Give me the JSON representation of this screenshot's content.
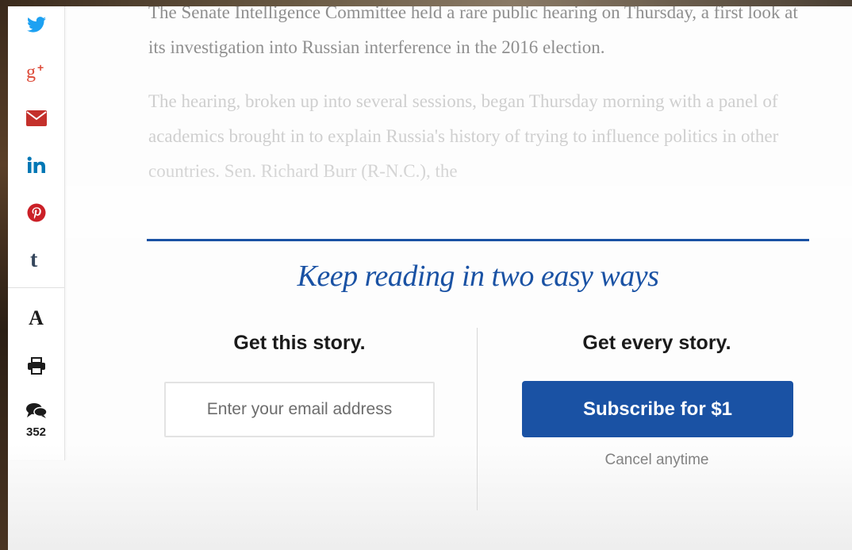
{
  "article": {
    "paragraph_1": "The Senate Intelligence Committee held a rare public hearing on Thursday, a first look at its investigation into Russian interference in the 2016 election.",
    "paragraph_2": "The hearing, broken up into several sessions, began Thursday morning with a panel of academics brought in to explain Russia's history of trying to influence politics in other countries. Sen. Richard Burr (R-N.C.), the"
  },
  "share_rail": {
    "icons": [
      "twitter-icon",
      "google-plus-icon",
      "email-icon",
      "linkedin-icon",
      "pinterest-icon",
      "tumblr-icon"
    ],
    "font_size_label": "A",
    "comment_count": "352"
  },
  "paywall": {
    "heading": "Keep reading in two easy ways",
    "left_heading": "Get this story.",
    "email_placeholder": "Enter your email address",
    "right_heading": "Get every story.",
    "subscribe_label": "Subscribe for $1",
    "cancel_note": "Cancel anytime"
  },
  "colors": {
    "brand_blue": "#1a52a4",
    "twitter": "#1da1f2",
    "google_plus": "#dd4b39",
    "email": "#c4302b",
    "linkedin": "#0077b5",
    "pinterest": "#cb2027",
    "tumblr": "#35465c"
  }
}
